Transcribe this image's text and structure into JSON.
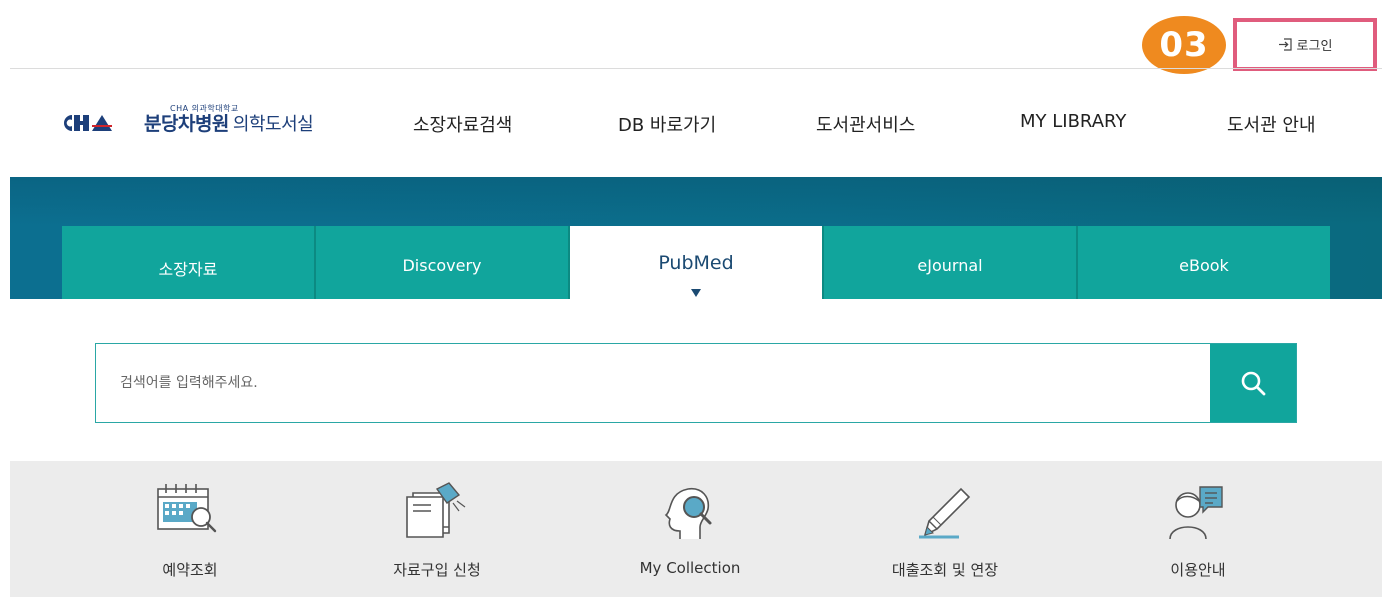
{
  "topbar": {
    "step_badge": "03",
    "login_label": "로그인",
    "highlight_color": "#e05c7d",
    "badge_color": "#ef8a1f"
  },
  "logo": {
    "mark": "CHA",
    "subtitle": "CHA 의과학대학교",
    "hospital": "분당차병원",
    "library": "의학도서실"
  },
  "nav": {
    "items": [
      "소장자료검색",
      "DB 바로가기",
      "도서관서비스",
      "MY LIBRARY",
      "도서관 안내"
    ]
  },
  "search_tabs": {
    "items": [
      "소장자료",
      "Discovery",
      "PubMed",
      "eJournal",
      "eBook"
    ],
    "active": "PubMed",
    "accent_color": "#11a59c"
  },
  "search": {
    "placeholder": "검색어를 입력해주세요.",
    "button_icon": "search-icon"
  },
  "quick_menu": {
    "items": [
      {
        "label": "예약조회",
        "icon": "calendar-search-icon"
      },
      {
        "label": "자료구입 신청",
        "icon": "book-request-icon"
      },
      {
        "label": "My Collection",
        "icon": "head-magnifier-icon"
      },
      {
        "label": "대출조회 및 연장",
        "icon": "pencil-icon"
      },
      {
        "label": "이용안내",
        "icon": "person-chat-icon"
      }
    ]
  }
}
